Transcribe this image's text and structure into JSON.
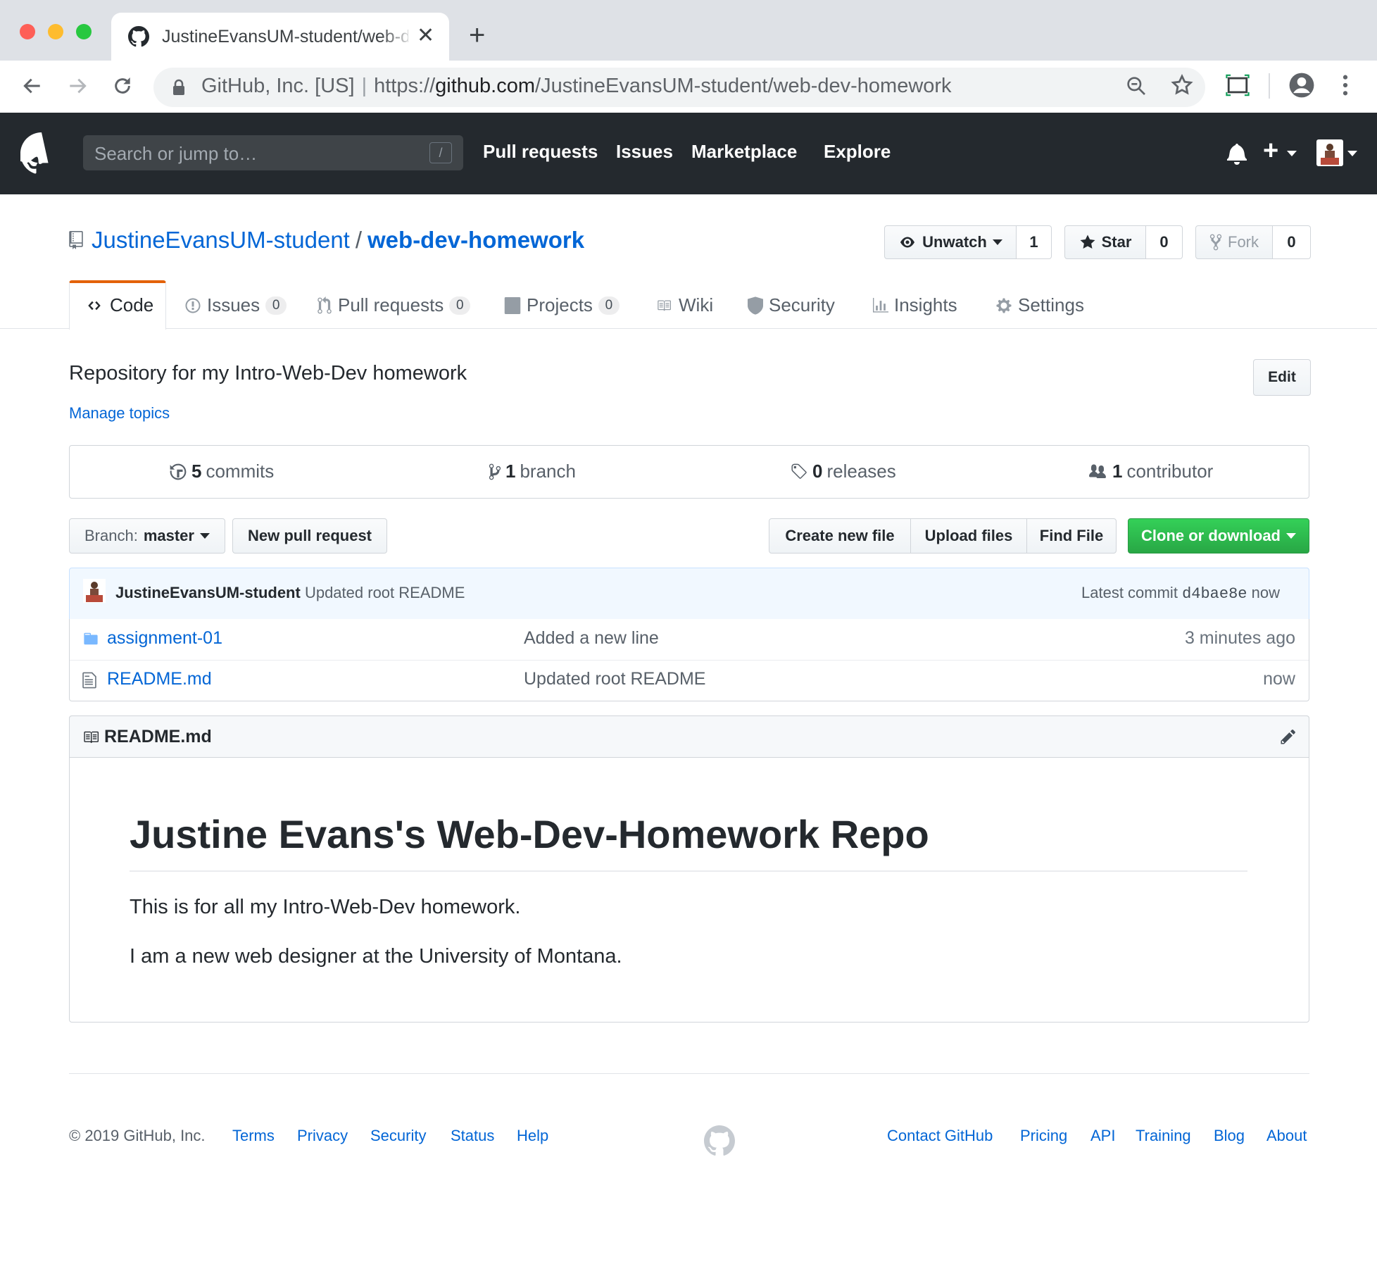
{
  "browser": {
    "tab_title": "JustineEvansUM-student/web-dev-homework",
    "new_tab": "+",
    "close": "✕",
    "site_identity": "GitHub, Inc. [US]",
    "url_scheme": "https://",
    "url_domain": "github.com",
    "url_path": "/JustineEvansUM-student/web-dev-homework"
  },
  "header": {
    "search_placeholder": "Search or jump to…",
    "search_key": "/",
    "nav": [
      "Pull requests",
      "Issues",
      "Marketplace",
      "Explore"
    ],
    "plus": "+"
  },
  "repo": {
    "owner": "JustineEvansUM-student",
    "separator": "/",
    "name": "web-dev-homework",
    "watch_label": "Unwatch",
    "watch_count": "1",
    "star_label": "Star",
    "star_count": "0",
    "fork_label": "Fork",
    "fork_count": "0"
  },
  "tabs": {
    "code": "Code",
    "issues": "Issues",
    "issues_count": "0",
    "pulls": "Pull requests",
    "pulls_count": "0",
    "projects": "Projects",
    "projects_count": "0",
    "wiki": "Wiki",
    "security": "Security",
    "insights": "Insights",
    "settings": "Settings"
  },
  "description": {
    "text": "Repository for my Intro-Web-Dev homework",
    "edit": "Edit",
    "manage_topics": "Manage topics"
  },
  "summary": {
    "commits_num": "5",
    "commits_label": "commits",
    "branches_num": "1",
    "branches_label": "branch",
    "releases_num": "0",
    "releases_label": "releases",
    "contributors_num": "1",
    "contributors_label": "contributor"
  },
  "file_nav": {
    "branch_prefix": "Branch:",
    "branch": "master",
    "new_pr": "New pull request",
    "create_file": "Create new file",
    "upload": "Upload files",
    "find": "Find File",
    "clone": "Clone or download"
  },
  "commit": {
    "author": "JustineEvansUM-student",
    "message": "Updated root README",
    "latest_label": "Latest commit",
    "sha": "d4bae8e",
    "time": "now"
  },
  "files": [
    {
      "name": "assignment-01",
      "type": "folder",
      "message": "Added a new line",
      "age": "3 minutes ago"
    },
    {
      "name": "README.md",
      "type": "file",
      "message": "Updated root README",
      "age": "now"
    }
  ],
  "readme": {
    "filename": "README.md",
    "heading": "Justine Evans's Web-Dev-Homework Repo",
    "para1": "This is for all my Intro-Web-Dev homework.",
    "para2": "I am a new web designer at the University of Montana."
  },
  "footer": {
    "copyright": "© 2019 GitHub, Inc.",
    "left_links": [
      "Terms",
      "Privacy",
      "Security",
      "Status",
      "Help"
    ],
    "right_links": [
      "Contact GitHub",
      "Pricing",
      "API",
      "Training",
      "Blog",
      "About"
    ]
  },
  "colors": {
    "header_bg": "#24292e",
    "link": "#0366d6",
    "clone_green": "#28a745",
    "active_tab": "#e36209"
  }
}
